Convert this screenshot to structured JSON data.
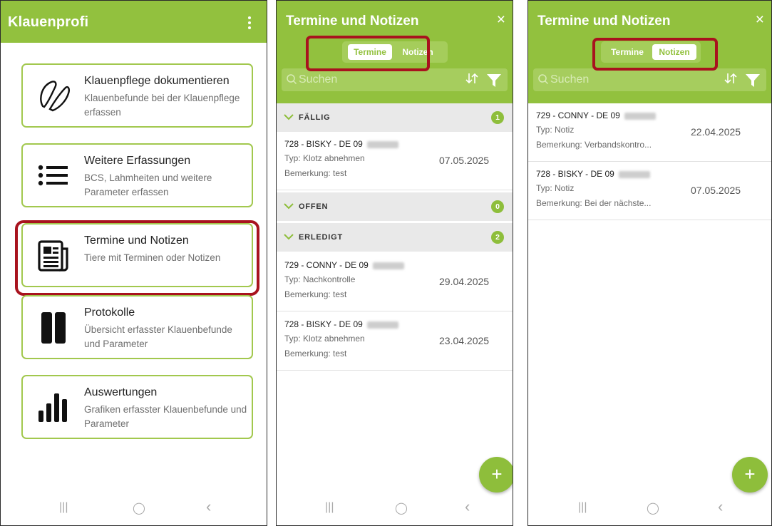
{
  "colors": {
    "brand_green": "#92c13e",
    "highlight_red": "#a8131e"
  },
  "main": {
    "app_title": "Klauenprofi",
    "menu_icon": "more-vertical-icon",
    "cards": [
      {
        "icon": "hoof-icon",
        "title": "Klauenpflege dokumentieren",
        "desc": "Klauenbefunde bei der Klauenpflege erfassen"
      },
      {
        "icon": "list-icon",
        "title": "Weitere Erfassungen",
        "desc": "BCS, Lahmheiten und weitere Parameter erfassen"
      },
      {
        "icon": "newspaper-icon",
        "title": "Termine und Notizen",
        "desc": "Tiere mit Terminen oder Notizen"
      },
      {
        "icon": "book-icon",
        "title": "Protokolle",
        "desc": "Übersicht erfasster Klauenbefunde und Parameter"
      },
      {
        "icon": "bar-chart-icon",
        "title": "Auswertungen",
        "desc": "Grafiken erfasster Klauenbefunde und Parameter"
      }
    ]
  },
  "termine": {
    "title": "Termine und Notizen",
    "close": "×",
    "tabs": [
      "Termine",
      "Notizen"
    ],
    "selected_tab": "Termine",
    "search_placeholder": "Suchen",
    "sections": [
      {
        "label": "FÄLLIG",
        "count": "1"
      },
      {
        "label": "OFFEN",
        "count": "0"
      },
      {
        "label": "ERLEDIGT",
        "count": "2"
      }
    ],
    "items": [
      {
        "name": "728 - BISKY - DE 09",
        "typ": "Typ: Klotz abnehmen",
        "bem": "Bemerkung: test",
        "date": "07.05.2025"
      },
      {
        "name": "729 - CONNY - DE 09",
        "typ": "Typ: Nachkontrolle",
        "bem": "Bemerkung: test",
        "date": "29.04.2025"
      },
      {
        "name": "728 - BISKY - DE 09",
        "typ": "Typ: Klotz abnehmen",
        "bem": "Bemerkung: test",
        "date": "23.04.2025"
      }
    ],
    "fab": "+"
  },
  "notizen": {
    "title": "Termine und Notizen",
    "close": "×",
    "tabs": [
      "Termine",
      "Notizen"
    ],
    "selected_tab": "Notizen",
    "search_placeholder": "Suchen",
    "items": [
      {
        "name": "729 - CONNY - DE 09",
        "typ": "Typ: Notiz",
        "bem": "Bemerkung: Verbandskontro...",
        "date": "22.04.2025"
      },
      {
        "name": "728 - BISKY - DE 09",
        "typ": "Typ: Notiz",
        "bem": "Bemerkung: Bei der nächste...",
        "date": "07.05.2025"
      }
    ],
    "fab": "+"
  },
  "navbar": {
    "recents": "|||",
    "home": "◯",
    "back": "‹"
  }
}
